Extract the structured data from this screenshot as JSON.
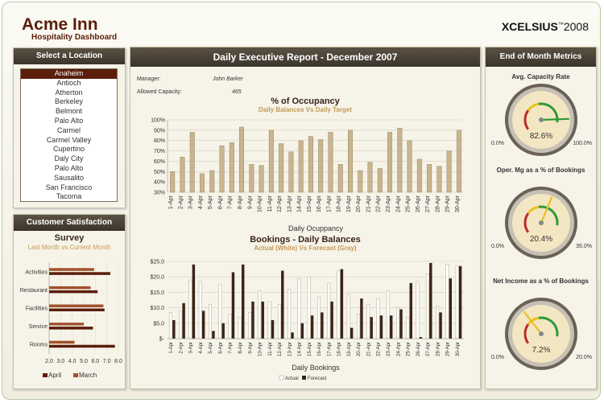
{
  "header": {
    "title": "Acme Inn",
    "subtitle": "Hospitality Dashboard",
    "brand": "XCELSIUS",
    "brand_version": "2008"
  },
  "location": {
    "heading": "Select a Location",
    "items": [
      "Anaheim",
      "Antioch",
      "Atherton",
      "Berkeley",
      "Belmont",
      "Palo Alto",
      "Carmel",
      "Carmel Valley",
      "Cupertino",
      "Daly City",
      "Palo Alto",
      "Sausalito",
      "San Francisco",
      "Tacoma"
    ],
    "selected": "Anaheim"
  },
  "satisfaction": {
    "heading": "Customer Satisfaction",
    "title": "Survey",
    "subtitle": "Last Month vs Current Month"
  },
  "report": {
    "heading": "Daily Executive Report - December 2007",
    "manager_label": "Manager:",
    "manager": "John Barker",
    "capacity_label": "Allowed Capacity:",
    "capacity": "465"
  },
  "metrics": {
    "heading": "End of Month Metrics",
    "gauges": [
      {
        "title": "Avg. Capacity Rate",
        "value": 82.6,
        "display": "82.6%",
        "min": "0.0%",
        "max": "100.0%",
        "range": [
          0,
          100
        ]
      },
      {
        "title": "Oper. Mg as a % of Bookings",
        "value": 20.4,
        "display": "20.4%",
        "min": "0.0%",
        "max": "35.0%",
        "range": [
          0,
          35
        ]
      },
      {
        "title": "Net Income as a % of Bookings",
        "value": 7.2,
        "display": "7.2%",
        "min": "0.0%",
        "max": "20.0%",
        "range": [
          0,
          20
        ]
      }
    ]
  },
  "colors": {
    "accent": "#5a1e0a",
    "bar_tan": "#c8b58e",
    "bar_dark": "#3a2418",
    "gold": "#c49a55",
    "panel_head": "#4a4236"
  },
  "chart_data": [
    {
      "type": "bar",
      "title": "% of Occupancy",
      "subtitle": "Daily Balances Vs Daily Target",
      "xlabel": "Daily Ocuppancy",
      "ylabel": "",
      "ylim": [
        30,
        100
      ],
      "yticks": [
        "30%",
        "40%",
        "50%",
        "60%",
        "70%",
        "80%",
        "90%",
        "100%"
      ],
      "categories": [
        "1-Apr",
        "2-Apr",
        "3-Apr",
        "4-Apr",
        "5-Apr",
        "6-Apr",
        "7-Apr",
        "8-Apr",
        "9-Apr",
        "10-Apr",
        "11-Apr",
        "12-Apr",
        "13-Apr",
        "14-Apr",
        "15-Apr",
        "16-Apr",
        "17-Apr",
        "18-Apr",
        "19-Apr",
        "20-Apr",
        "21-Apr",
        "22-Apr",
        "23-Apr",
        "24-Apr",
        "25-Apr",
        "26-Apr",
        "27-Apr",
        "28-Apr",
        "29-Apr",
        "30-Apr"
      ],
      "values": [
        50,
        64,
        88,
        48,
        51,
        75,
        78,
        93,
        57,
        56,
        90,
        77,
        69,
        80,
        84,
        81,
        88,
        57,
        90,
        51,
        59,
        53,
        88,
        92,
        80,
        62,
        57,
        55,
        70,
        90
      ]
    },
    {
      "type": "bar",
      "title": "Bookings - Daily Balances",
      "subtitle": "Actual (White) Vs Forecast (Gray)",
      "xlabel": "Daily Bookings",
      "ylim": [
        0,
        25
      ],
      "yticks": [
        "$-",
        "$5.0",
        "$10.0",
        "$15.0",
        "$20.0",
        "$25.0"
      ],
      "categories": [
        "1-Apr",
        "2-Apr",
        "3-Apr",
        "4-Apr",
        "5-Apr",
        "6-Apr",
        "7-Apr",
        "8-Apr",
        "9-Apr",
        "10-Apr",
        "11-Apr",
        "12-Apr",
        "13-Apr",
        "14-Apr",
        "15-Apr",
        "16-Apr",
        "17-Apr",
        "18-Apr",
        "19-Apr",
        "20-Apr",
        "21-Apr",
        "22-Apr",
        "23-Apr",
        "24-Apr",
        "25-Apr",
        "26-Apr",
        "27-Apr",
        "28-Apr",
        "29-Apr",
        "30-Apr"
      ],
      "series": [
        {
          "name": "Actual",
          "values": [
            8.5,
            9.0,
            19.0,
            18.5,
            11.0,
            17.5,
            8.0,
            7.0,
            8.5,
            15.5,
            12.0,
            11.0,
            16.0,
            19.5,
            20.0,
            13.5,
            18.0,
            22.0,
            14.5,
            8.0,
            11.0,
            13.0,
            15.5,
            10.0,
            7.0,
            18.5,
            21.0,
            10.5,
            24.0,
            23.5
          ]
        },
        {
          "name": "Forecast",
          "values": [
            6.0,
            11.5,
            24.0,
            9.0,
            2.5,
            5.0,
            21.5,
            24.0,
            12.0,
            12.0,
            6.0,
            22.0,
            2.0,
            5.0,
            7.5,
            8.5,
            12.0,
            22.5,
            3.5,
            13.0,
            7.0,
            7.5,
            7.5,
            9.5,
            18.0,
            0.5,
            24.5,
            8.5,
            19.5,
            23.5
          ]
        }
      ],
      "legend": "bottom"
    },
    {
      "type": "bar",
      "orientation": "horizontal",
      "categories": [
        "Activities",
        "Restaurant",
        "Facilities",
        "Service",
        "Rooms"
      ],
      "xlim": [
        2.0,
        8.0
      ],
      "xticks": [
        "2.0",
        "3.0",
        "4.0",
        "5.0",
        "6.0",
        "7.0",
        "8.0"
      ],
      "series": [
        {
          "name": "April",
          "values": [
            7.3,
            6.2,
            6.8,
            5.8,
            7.7
          ]
        },
        {
          "name": "March",
          "values": [
            5.9,
            5.6,
            6.7,
            5.0,
            4.2
          ]
        }
      ],
      "legend": "bottom"
    }
  ]
}
